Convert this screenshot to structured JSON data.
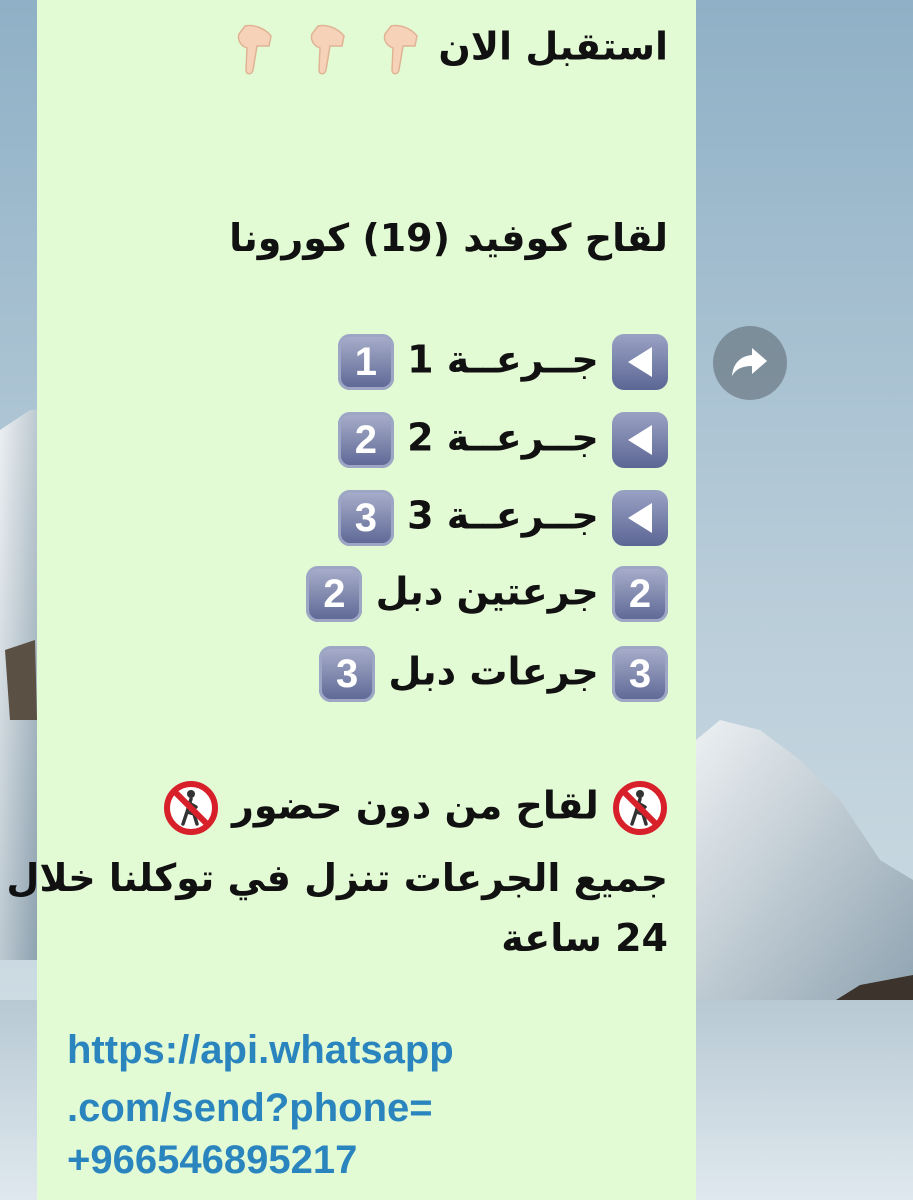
{
  "message": {
    "line1": "استقبل الان",
    "line2": "لقاح كوفيد (19) كورونا",
    "doses": [
      {
        "label": "جــرعــة 1",
        "keycap": "1"
      },
      {
        "label": "جــرعــة 2",
        "keycap": "2"
      },
      {
        "label": "جــرعــة 3",
        "keycap": "3"
      }
    ],
    "double_doses": [
      {
        "prefix": "2",
        "label": "جرعتين دبل",
        "keycap": "2"
      },
      {
        "prefix": "3",
        "label": "جرعات دبل",
        "keycap": "3"
      }
    ],
    "no_attendance": "لقاح من دون حضور",
    "info_line1": "جميع الجرعات تنزل في توكلنا خلال",
    "info_line2": "24 ساعة",
    "link_lines": [
      "https://api.whatsapp",
      ".com/send?phone=",
      "+966546895217"
    ]
  },
  "icons": {
    "pointer": "backhand-index-pointing-down-emoji",
    "play": "reverse-button-emoji",
    "keycap": "keycap-digit-emoji",
    "no_pedestrians": "no-pedestrians-emoji",
    "share": "forward-share-icon"
  },
  "colors": {
    "bubble_bg": "#e3fbd5",
    "link": "#2a84be",
    "keycap": "#6b74a0"
  }
}
